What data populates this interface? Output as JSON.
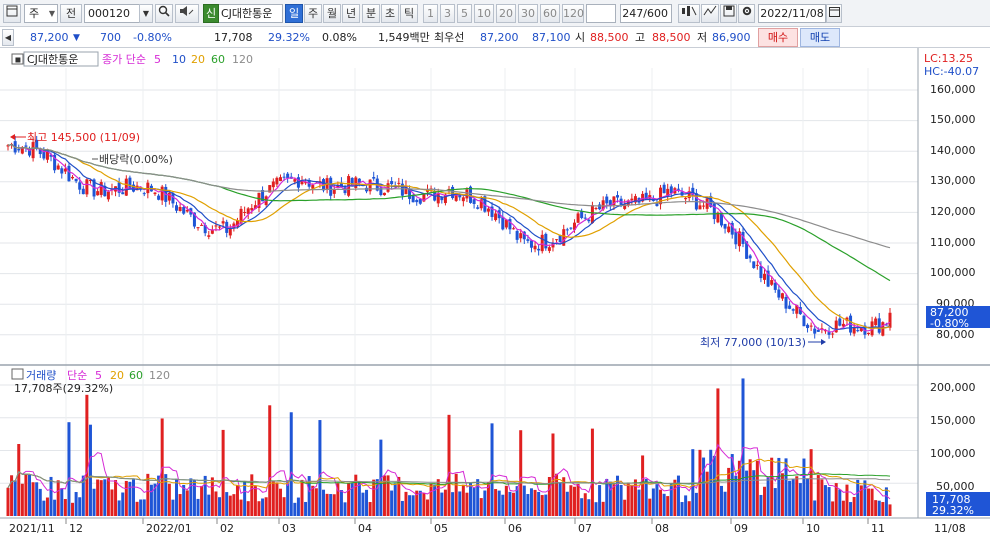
{
  "toolbar": {
    "period_label": "주",
    "prev_label": "전",
    "code": "000120",
    "credit_badge": "신",
    "stock_name": "CJ대한통운",
    "periods": [
      "일",
      "주",
      "월",
      "년",
      "분",
      "초",
      "틱"
    ],
    "active_period": "일",
    "intervals": [
      "1",
      "3",
      "5",
      "10",
      "20",
      "30",
      "60",
      "120"
    ],
    "count": "247/600",
    "date": "2022/11/08"
  },
  "info": {
    "price": "87,200",
    "change": "700",
    "change_pct": "-0.80%",
    "volume": "17,708",
    "volume_ratio": "29.32%",
    "turnover": "0.08%",
    "amount": "1,549백만",
    "best_label": "최우선",
    "best_ask": "87,200",
    "best_bid": "87,100",
    "open_label": "시",
    "open": "88,500",
    "high_label": "고",
    "high": "88,500",
    "low_label": "저",
    "low": "86,900",
    "buy_label": "매수",
    "sell_label": "매도"
  },
  "legend": {
    "name": "CJ대한통운",
    "ma_label": "종가 단순",
    "ma_periods": [
      "5",
      "10",
      "20",
      "60",
      "120"
    ],
    "lc": "LC:13.25",
    "hc": "HC:-40.07"
  },
  "annotations": {
    "high": "최고 145,500 (11/09)",
    "low": "최저 77,000 (10/13)",
    "dividend": "배당락(0.00%)"
  },
  "price_axis": [
    "160,000",
    "150,000",
    "140,000",
    "130,000",
    "120,000",
    "110,000",
    "100,000",
    "90,000",
    "80,000"
  ],
  "price_tag": {
    "price": "87,200",
    "pct": "-0.80%"
  },
  "volume_legend": {
    "label": "거래량",
    "ma_label": "단순",
    "ma_periods": [
      "5",
      "20",
      "60",
      "120"
    ],
    "value": "17,708주(29.32%)"
  },
  "volume_axis": [
    "200,000",
    "150,000",
    "100,000",
    "50,000"
  ],
  "volume_tag": {
    "volume": "17,708",
    "pct": "29.32%"
  },
  "time_axis": [
    "2021/11",
    "12",
    "2022/01",
    "02",
    "03",
    "04",
    "05",
    "06",
    "07",
    "08",
    "09",
    "10",
    "11",
    "11/08"
  ],
  "colors": {
    "up": "#e02020",
    "down": "#1f55d6",
    "ma5": "#d62ad6",
    "ma10": "#1f4fc8",
    "ma20": "#e0a000",
    "ma60": "#2aa02a",
    "ma120": "#8c8c8c"
  },
  "chart_data": {
    "type": "candlestick",
    "x_range": [
      "2021/11",
      "2022/11/08"
    ],
    "ylim": [
      75000,
      165000
    ],
    "volume_ylim": [
      0,
      220000
    ],
    "price_keypoints": [
      {
        "x": "2021/11",
        "close": 142000
      },
      {
        "x": "2021/12",
        "close": 131000
      },
      {
        "x": "2022/01",
        "close": 125000
      },
      {
        "x": "2022/02",
        "close": 115000
      },
      {
        "x": "2022/03",
        "close": 133000
      },
      {
        "x": "2022/04",
        "close": 126000
      },
      {
        "x": "2022/05",
        "close": 129000
      },
      {
        "x": "2022/06",
        "close": 111000
      },
      {
        "x": "2022/07",
        "close": 118000
      },
      {
        "x": "2022/08",
        "close": 129000
      },
      {
        "x": "2022/09",
        "close": 110000
      },
      {
        "x": "2022/10",
        "close": 79000
      },
      {
        "x": "2022/11/08",
        "close": 87200
      }
    ],
    "high": 145500,
    "low": 77000,
    "last_close": 87200
  }
}
